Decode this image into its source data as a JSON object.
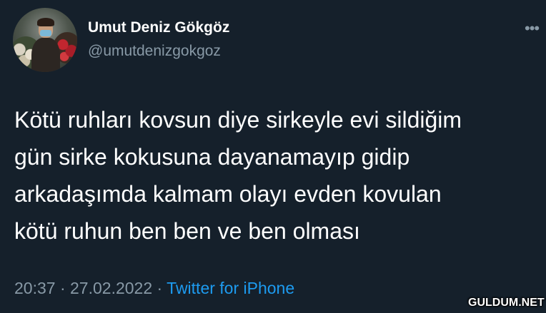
{
  "tweet": {
    "author": {
      "display_name": "Umut Deniz Gökgöz",
      "handle": "@umutdenizgokgoz"
    },
    "more_icon": "more-horizontal-icon",
    "more_label": "•••",
    "text_lines": [
      "Kötü ruhları kovsun diye sirkeyle evi sildiğim",
      "gün sirke kokusuna dayanamayıp gidip",
      "arkadaşımda kalmam olayı evden kovulan",
      "kötü ruhun ben ben ve ben olması"
    ],
    "meta": {
      "time": "20:37",
      "separator": " · ",
      "date": "27.02.2022",
      "source": "Twitter for iPhone"
    }
  },
  "watermark": "GULDUM.NET",
  "colors": {
    "background": "#15202b",
    "secondary_text": "#8899a6",
    "link": "#1d9bf0"
  }
}
